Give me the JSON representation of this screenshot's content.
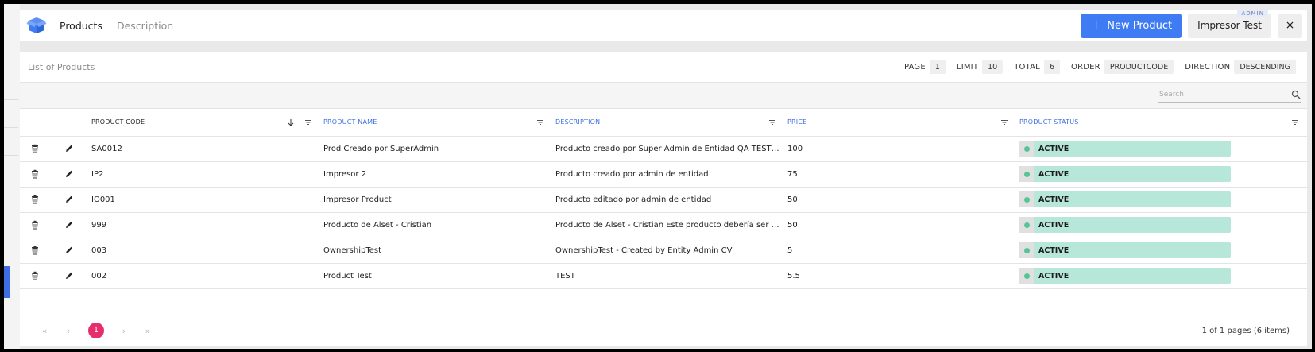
{
  "header": {
    "tabs": [
      {
        "label": "Products",
        "active": true
      },
      {
        "label": "Description",
        "active": false
      }
    ],
    "new_button_label": "New Product",
    "new_button_icon": "plus-icon",
    "user_name": "Impresor Test",
    "user_role": "ADMIN",
    "close_label": "×"
  },
  "list": {
    "title": "List of Products",
    "page_label": "PAGE",
    "page_value": "1",
    "limit_label": "LIMIT",
    "limit_value": "10",
    "total_label": "TOTAL",
    "total_value": "6",
    "order_label": "ORDER",
    "order_value": "PRODUCTCODE",
    "direction_label": "DIRECTION",
    "direction_value": "DESCENDING",
    "search_placeholder": "Search"
  },
  "columns": [
    {
      "label": "PRODUCT CODE",
      "sorted": true
    },
    {
      "label": "PRODUCT NAME",
      "sorted": false
    },
    {
      "label": "DESCRIPTION",
      "sorted": false
    },
    {
      "label": "PRICE",
      "sorted": false
    },
    {
      "label": "PRODUCT STATUS",
      "sorted": false
    }
  ],
  "rows": [
    {
      "code": "SA0012",
      "name": "Prod Creado por SuperAdmin",
      "description": "Producto creado por Super Admin de Entidad QA TEST p...",
      "price": "100",
      "status": "ACTIVE"
    },
    {
      "code": "IP2",
      "name": "Impresor 2",
      "description": "Producto creado por admin de entidad",
      "price": "75",
      "status": "ACTIVE"
    },
    {
      "code": "IO001",
      "name": "Impresor Product",
      "description": "Producto editado por admin de entidad",
      "price": "50",
      "status": "ACTIVE"
    },
    {
      "code": "999",
      "name": "Producto de Alset - Cristian",
      "description": "Producto de Alset - Cristian Este producto debería ser e...",
      "price": "50",
      "status": "ACTIVE"
    },
    {
      "code": "003",
      "name": "OwnershipTest",
      "description": "OwnershipTest - Created by Entity Admin CV",
      "price": "5",
      "status": "ACTIVE"
    },
    {
      "code": "002",
      "name": "Product Test",
      "description": "TEST",
      "price": "5.5",
      "status": "ACTIVE"
    }
  ],
  "pager": {
    "first": "«",
    "prev": "‹",
    "current": "1",
    "next": "›",
    "last": "»",
    "info": "1 of 1 pages (6 items)"
  },
  "colors": {
    "accent": "#3f7cf3",
    "status_bg": "#b6e7d8",
    "status_dot": "#56c596",
    "pager_current": "#e52e6b"
  }
}
